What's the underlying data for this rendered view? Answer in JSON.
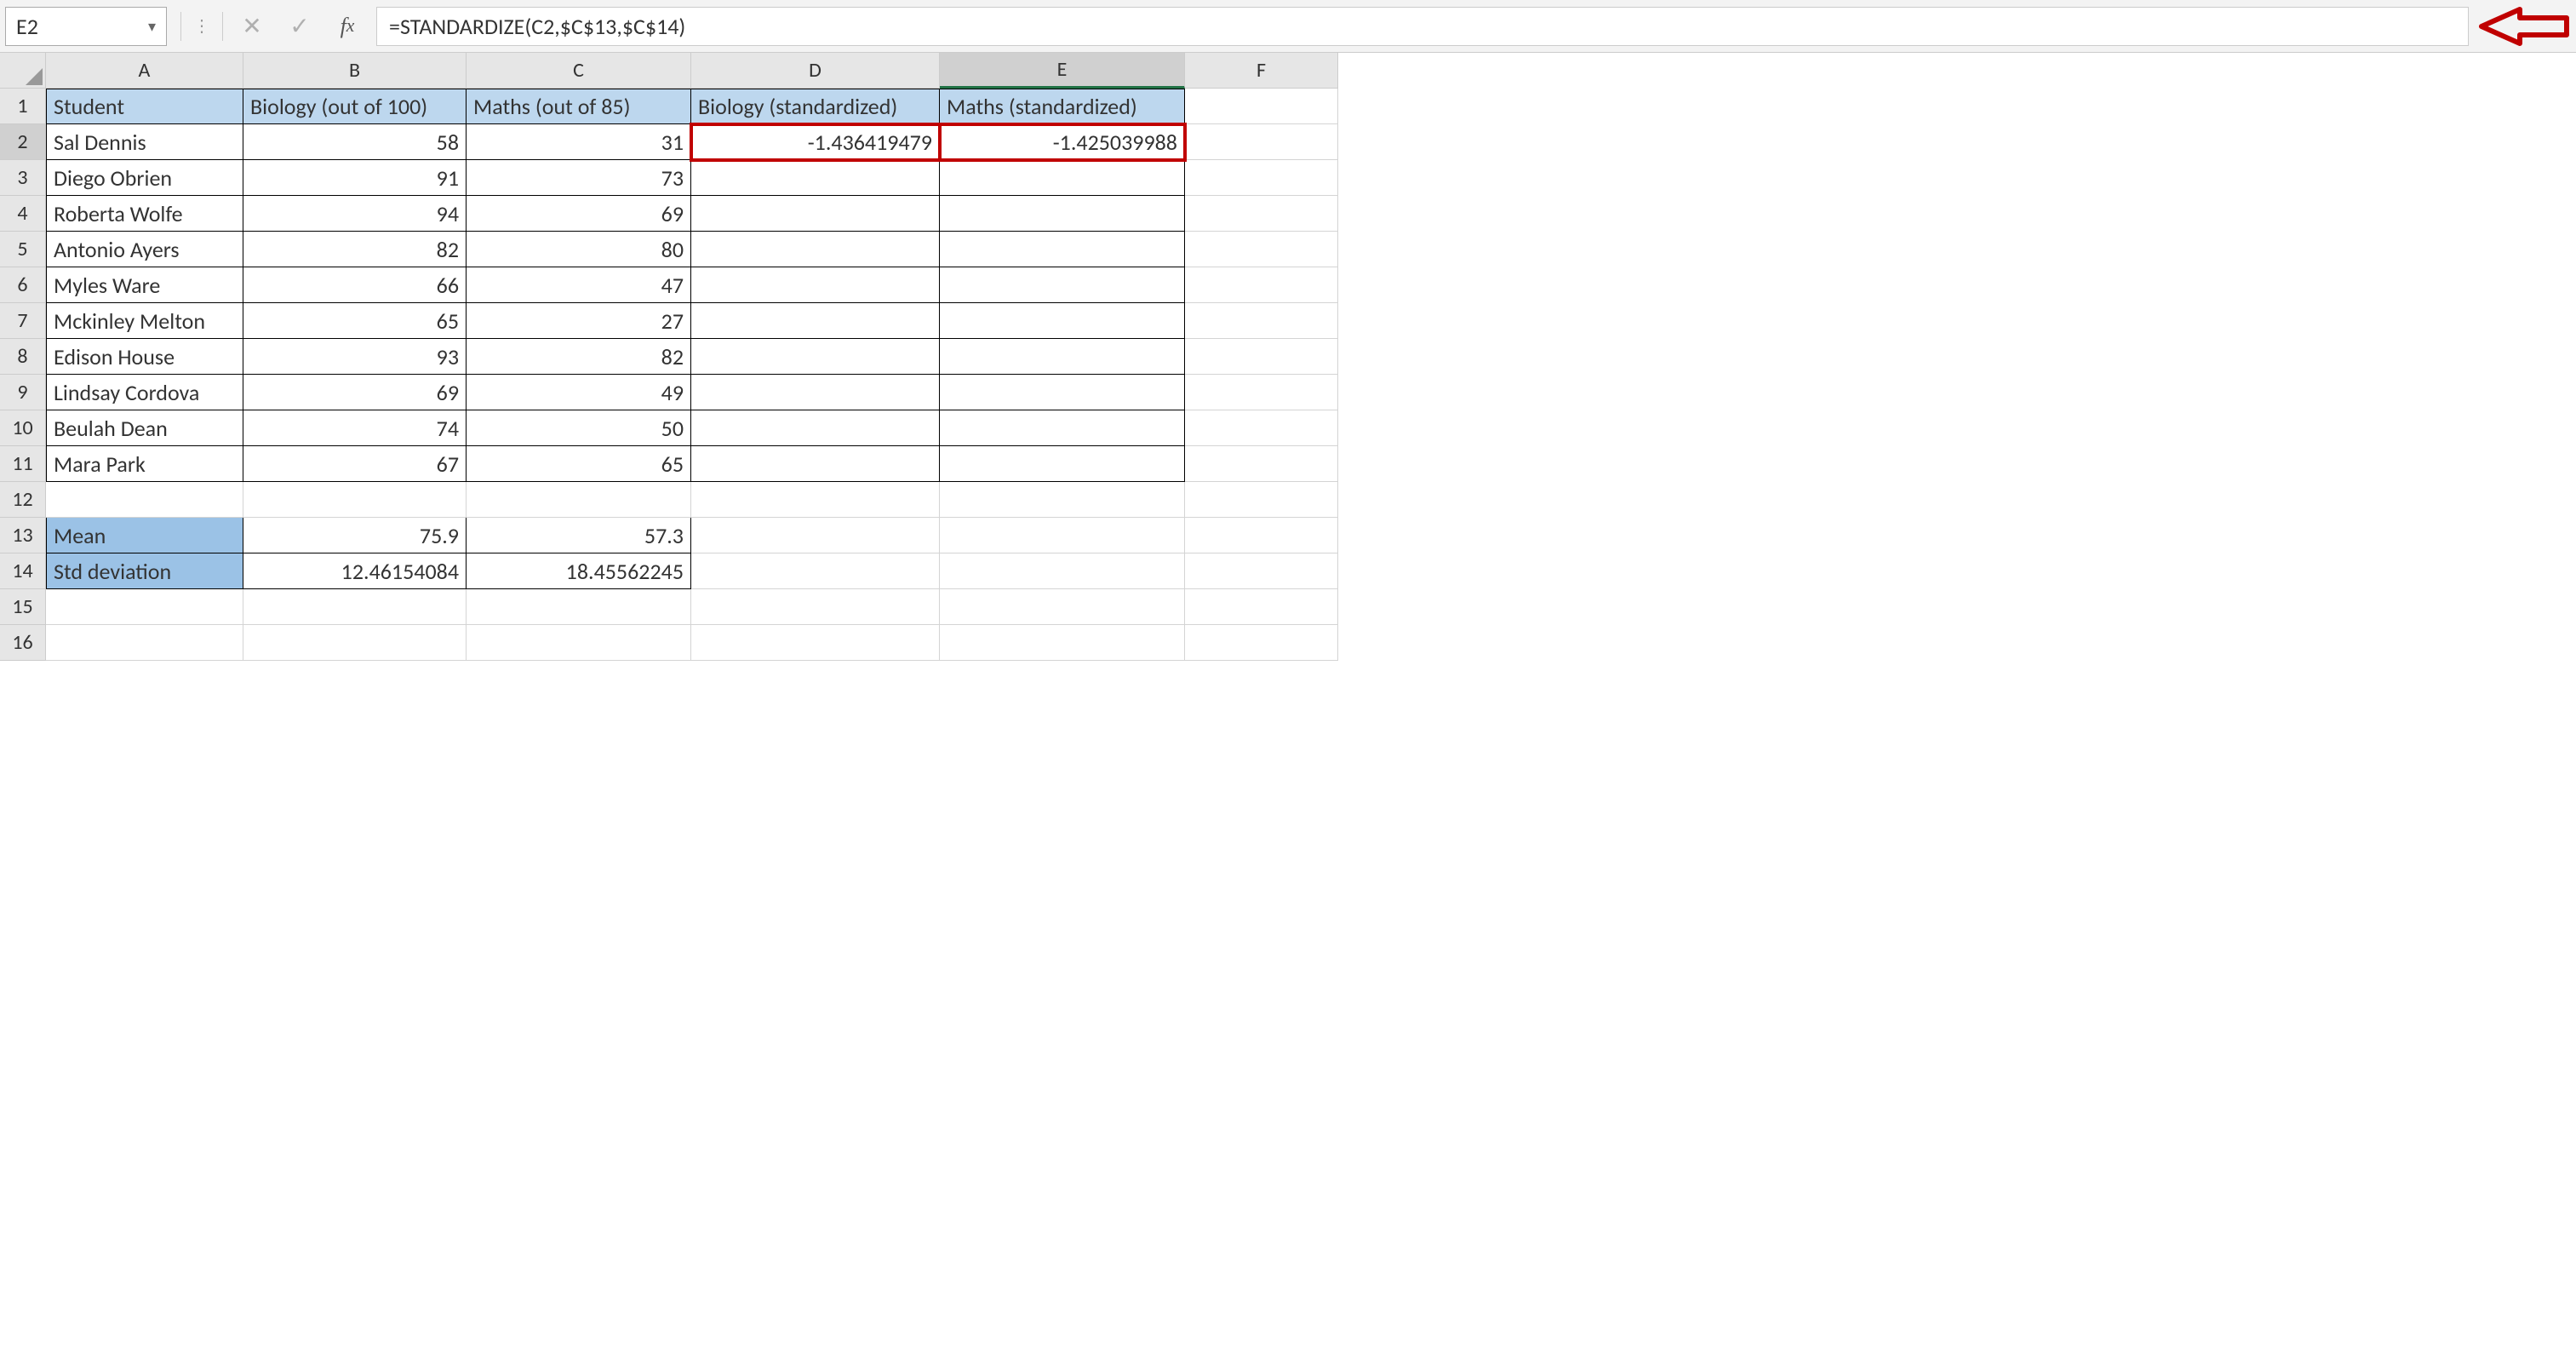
{
  "name_box": "E2",
  "formula": "=STANDARDIZE(C2,$C$13,$C$14)",
  "col_labels": [
    "A",
    "B",
    "C",
    "D",
    "E",
    "F"
  ],
  "row_labels": [
    "1",
    "2",
    "3",
    "4",
    "5",
    "6",
    "7",
    "8",
    "9",
    "10",
    "11",
    "12",
    "13",
    "14",
    "15",
    "16"
  ],
  "headers": {
    "a": "Student",
    "b": "Biology (out of 100)",
    "c": "Maths (out of 85)",
    "d": "Biology (standardized)",
    "e": "Maths (standardized)"
  },
  "rows": [
    {
      "student": "Sal Dennis",
      "bio": "58",
      "math": "31",
      "bio_std": "-1.436419479",
      "math_std": "-1.425039988"
    },
    {
      "student": "Diego Obrien",
      "bio": "91",
      "math": "73",
      "bio_std": "",
      "math_std": ""
    },
    {
      "student": "Roberta Wolfe",
      "bio": "94",
      "math": "69",
      "bio_std": "",
      "math_std": ""
    },
    {
      "student": "Antonio Ayers",
      "bio": "82",
      "math": "80",
      "bio_std": "",
      "math_std": ""
    },
    {
      "student": "Myles Ware",
      "bio": "66",
      "math": "47",
      "bio_std": "",
      "math_std": ""
    },
    {
      "student": "Mckinley Melton",
      "bio": "65",
      "math": "27",
      "bio_std": "",
      "math_std": ""
    },
    {
      "student": "Edison House",
      "bio": "93",
      "math": "82",
      "bio_std": "",
      "math_std": ""
    },
    {
      "student": "Lindsay Cordova",
      "bio": "69",
      "math": "49",
      "bio_std": "",
      "math_std": ""
    },
    {
      "student": "Beulah Dean",
      "bio": "74",
      "math": "50",
      "bio_std": "",
      "math_std": ""
    },
    {
      "student": "Mara Park",
      "bio": "67",
      "math": "65",
      "bio_std": "",
      "math_std": ""
    }
  ],
  "stats": {
    "mean_label": "Mean",
    "std_label": "Std deviation",
    "mean_bio": "75.9",
    "mean_math": "57.3",
    "std_bio": "12.46154084",
    "std_math": "18.45562245"
  },
  "chart_data": {
    "type": "table",
    "title": "Student scores with standardized values",
    "columns": [
      "Student",
      "Biology (out of 100)",
      "Maths (out of 85)",
      "Biology (standardized)",
      "Maths (standardized)"
    ],
    "rows": [
      [
        "Sal Dennis",
        58,
        31,
        -1.436419479,
        -1.425039988
      ],
      [
        "Diego Obrien",
        91,
        73,
        null,
        null
      ],
      [
        "Roberta Wolfe",
        94,
        69,
        null,
        null
      ],
      [
        "Antonio Ayers",
        82,
        80,
        null,
        null
      ],
      [
        "Myles Ware",
        66,
        47,
        null,
        null
      ],
      [
        "Mckinley Melton",
        65,
        27,
        null,
        null
      ],
      [
        "Edison House",
        93,
        82,
        null,
        null
      ],
      [
        "Lindsay Cordova",
        69,
        49,
        null,
        null
      ],
      [
        "Beulah Dean",
        74,
        50,
        null,
        null
      ],
      [
        "Mara Park",
        67,
        65,
        null,
        null
      ]
    ],
    "summary": {
      "Mean": {
        "Biology": 75.9,
        "Maths": 57.3
      },
      "Std deviation": {
        "Biology": 12.46154084,
        "Maths": 18.45562245
      }
    }
  }
}
